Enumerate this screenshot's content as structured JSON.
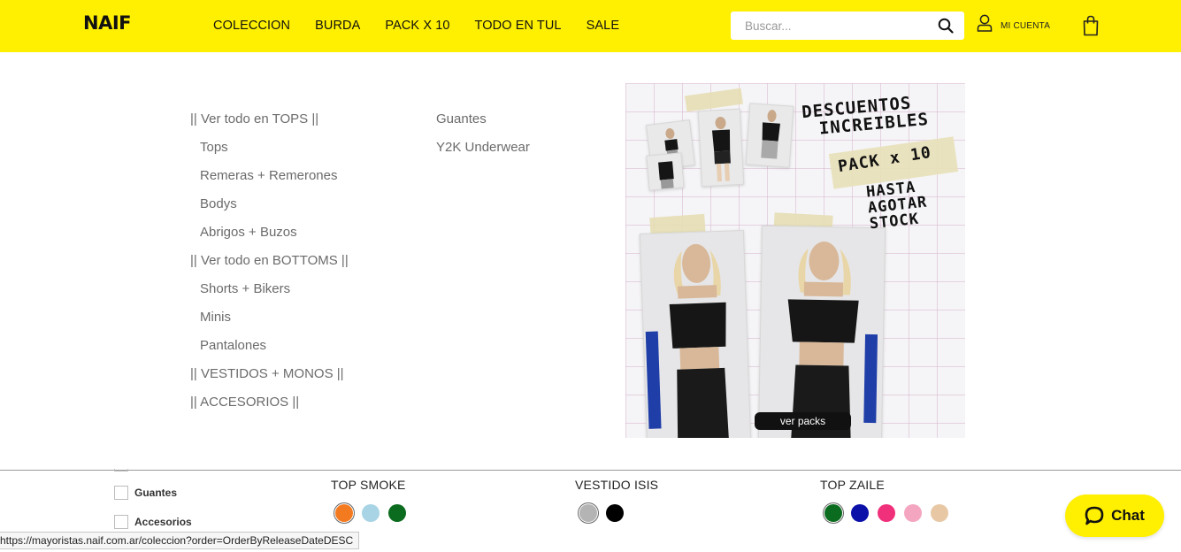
{
  "header": {
    "logo": "NAIF",
    "nav": [
      "COLECCION",
      "BURDA",
      "PACK X 10",
      "TODO EN TUL",
      "SALE"
    ],
    "search_placeholder": "Buscar...",
    "account_label": "MI CUENTA"
  },
  "menu": {
    "col1": [
      {
        "label": "|| Ver todo en TOPS ||",
        "sub": false
      },
      {
        "label": "Tops",
        "sub": true
      },
      {
        "label": "Remeras + Remerones",
        "sub": true
      },
      {
        "label": "Bodys",
        "sub": true
      },
      {
        "label": "Abrigos + Buzos",
        "sub": true
      },
      {
        "label": "|| Ver todo en BOTTOMS ||",
        "sub": false
      },
      {
        "label": "Shorts + Bikers",
        "sub": true
      },
      {
        "label": "Minis",
        "sub": true
      },
      {
        "label": "Pantalones",
        "sub": true
      },
      {
        "label": "|| VESTIDOS + MONOS ||",
        "sub": false
      },
      {
        "label": "|| ACCESORIOS ||",
        "sub": false
      }
    ],
    "col2": [
      "Guantes",
      "Y2K Underwear"
    ]
  },
  "promo": {
    "headline_1": "DESCUENTOS",
    "headline_2": "INCREIBLES",
    "pack_text": "PACK x 10",
    "stock_1": "HASTA",
    "stock_2": "AGOTAR",
    "stock_3": "STOCK",
    "button": "ver packs"
  },
  "filters": [
    "Guantes",
    "Accesorios"
  ],
  "products": [
    {
      "name": "TOP SMOKE",
      "swatches": [
        "#f47a20",
        "#a8d4e6",
        "#0b6b1e"
      ],
      "selected": 0
    },
    {
      "name": "VESTIDO ISIS",
      "swatches": [
        "#b4b4b4",
        "#000000"
      ],
      "selected": 0
    },
    {
      "name": "TOP ZAILE",
      "swatches": [
        "#0b6b1e",
        "#0a10a8",
        "#f0307a",
        "#f4a6c0",
        "#e8c8a4"
      ],
      "selected": 0
    }
  ],
  "status_url": "https://mayoristas.naif.com.ar/coleccion?order=OrderByReleaseDateDESC",
  "chat_label": "Chat",
  "colors": {
    "brand_yellow": "#ffef00",
    "menu_text": "#6b6b6b"
  }
}
